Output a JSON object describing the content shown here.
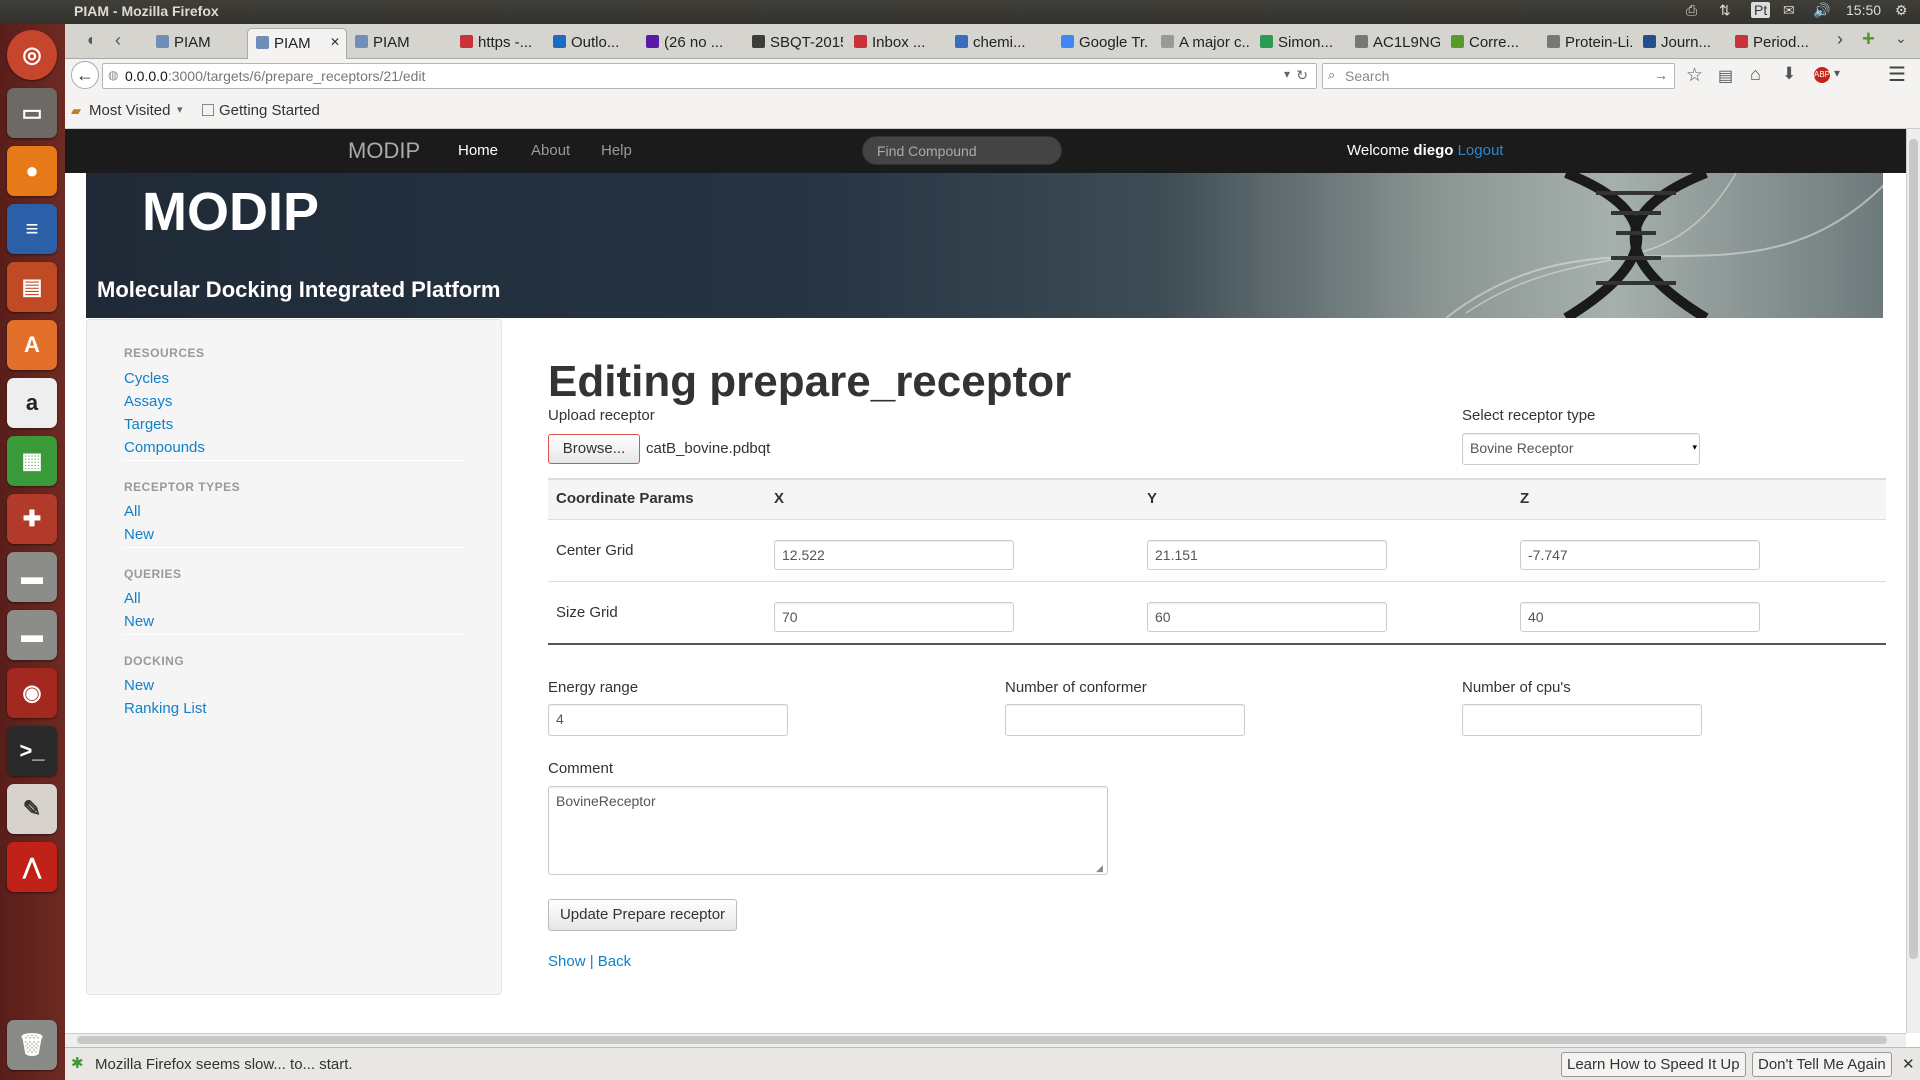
{
  "os": {
    "window_title": "PIAM - Mozilla Firefox",
    "clock": "15:50",
    "tray_pt": "Pt"
  },
  "tabs": [
    {
      "label": "PIAM",
      "color": "#6d8fb9"
    },
    {
      "label": "PIAM",
      "color": "#6d8fb9"
    },
    {
      "label": "PIAM",
      "color": "#6d8fb9"
    },
    {
      "label": "https -...",
      "color": "#c8323a"
    },
    {
      "label": "Outlo...",
      "color": "#1b6bc2"
    },
    {
      "label": "(26 no ...",
      "color": "#5b1aa3"
    },
    {
      "label": "SBQT-2015",
      "color": "#3c3c3c"
    },
    {
      "label": "Inbox ...",
      "color": "#c8323a"
    },
    {
      "label": "chemi...",
      "color": "#3a6bbf"
    },
    {
      "label": "Google Tr...",
      "color": "#4285f4"
    },
    {
      "label": "A major c...",
      "color": "#999999"
    },
    {
      "label": "Simon...",
      "color": "#2b9a54"
    },
    {
      "label": "AC1L9NG...",
      "color": "#777777"
    },
    {
      "label": "Corre...",
      "color": "#5a9a2c"
    },
    {
      "label": "Protein-Li...",
      "color": "#777777"
    },
    {
      "label": "Journ...",
      "color": "#234f8c"
    },
    {
      "label": "Period...",
      "color": "#c8323a"
    }
  ],
  "browser": {
    "url_host": "0.0.0.0",
    "url_rest": ":3000/targets/6/prepare_receptors/21/edit",
    "search_placeholder": "Search",
    "bookmarks": [
      "Most Visited",
      "Getting Started"
    ]
  },
  "app": {
    "brand": "MODIP",
    "nav": [
      "Home",
      "About",
      "Help"
    ],
    "find_placeholder": "Find Compound",
    "welcome_prefix": "Welcome ",
    "user": "diego",
    "logout": "Logout",
    "banner_title": "MODIP",
    "banner_subtitle": "Molecular Docking Integrated Platform"
  },
  "sidebar": {
    "sections": [
      {
        "title": "RESOURCES",
        "items": [
          "Cycles",
          "Assays",
          "Targets",
          "Compounds"
        ]
      },
      {
        "title": "RECEPTOR TYPES",
        "items": [
          "All",
          "New"
        ]
      },
      {
        "title": "QUERIES",
        "items": [
          "All",
          "New"
        ]
      },
      {
        "title": "DOCKING",
        "items": [
          "New",
          "Ranking List"
        ]
      }
    ]
  },
  "form": {
    "heading": "Editing prepare_receptor",
    "upload_label": "Upload receptor",
    "browse_label": "Browse...",
    "file_name": "catB_bovine.pdbqt",
    "receptor_type_label": "Select receptor type",
    "receptor_type_value": "Bovine Receptor",
    "coord_header": "Coordinate Params",
    "col_x": "X",
    "col_y": "Y",
    "col_z": "Z",
    "center_label": "Center Grid",
    "center": [
      "12.522",
      "21.151",
      "-7.747"
    ],
    "size_label": "Size Grid",
    "size": [
      "70",
      "60",
      "40"
    ],
    "energy_label": "Energy range",
    "energy_value": "4",
    "conformer_label": "Number of conformer",
    "conformer_value": "",
    "cpu_label": "Number of cpu's",
    "cpu_value": "",
    "comment_label": "Comment",
    "comment_value": "BovineReceptor",
    "submit_label": "Update Prepare receptor",
    "show_link": "Show",
    "sep": " | ",
    "back_link": "Back"
  },
  "status": {
    "message": "Mozilla Firefox seems slow... to... start.",
    "learn": "Learn How to Speed It Up",
    "dont": "Don't Tell Me Again"
  }
}
